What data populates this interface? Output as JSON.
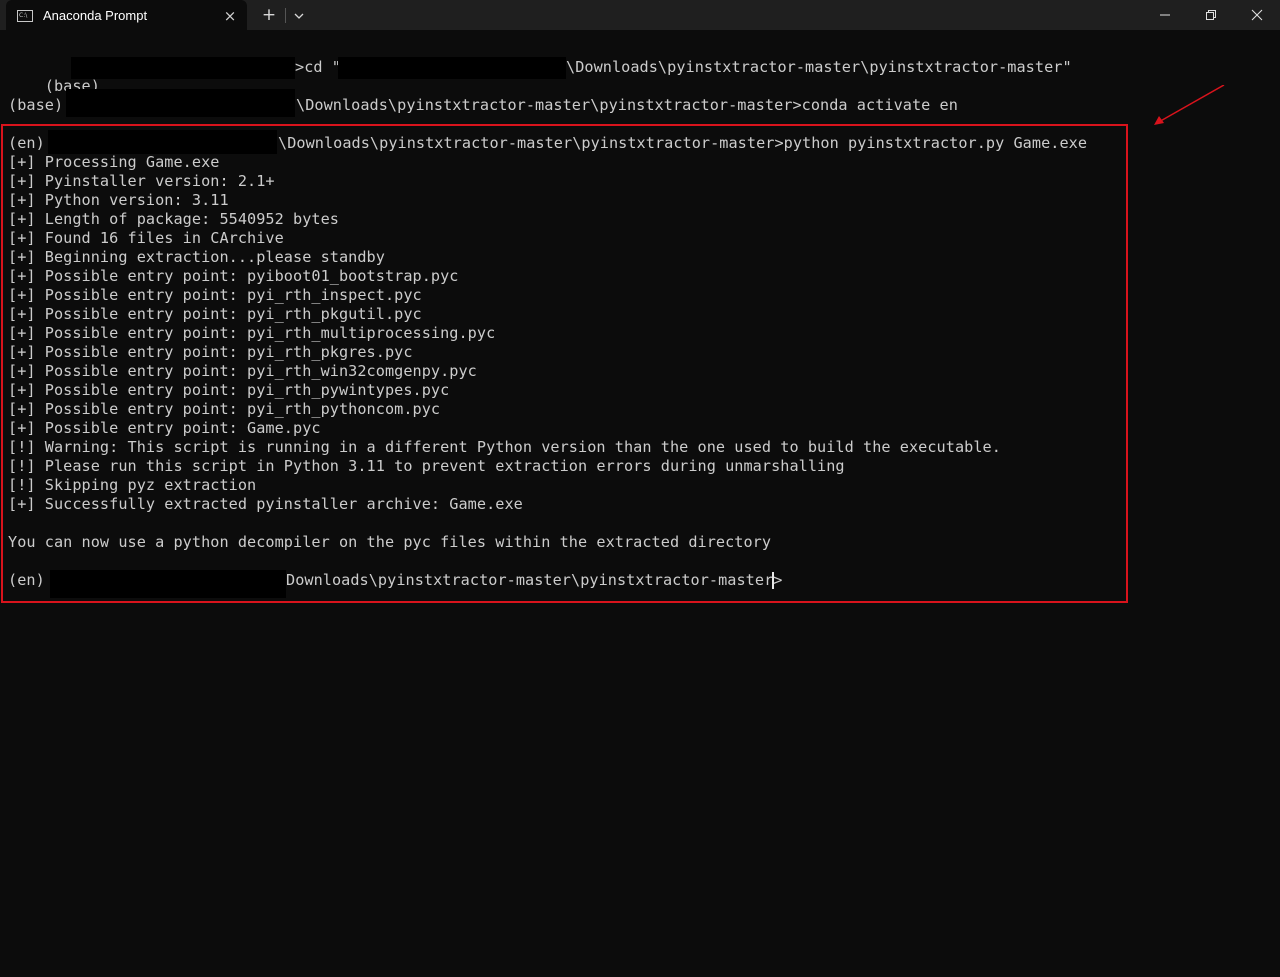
{
  "window": {
    "tab_title": "Anaconda Prompt",
    "tab_icon": "cmd-prompt-icon",
    "new_tab_icon": "+",
    "close_tab_icon": "×"
  },
  "colors": {
    "terminal_bg": "#0c0c0c",
    "terminal_fg": "#cccccc",
    "highlight": "#d9131c"
  },
  "terminal": {
    "line1_prefix": "(base) ",
    "line1_cmd": ">cd \"",
    "line1_path": "\\Downloads\\pyinstxtractor-master\\pyinstxtractor-master\"",
    "line2_prefix": "(base) ",
    "line2_rest": "\\Downloads\\pyinstxtractor-master\\pyinstxtractor-master>conda activate en",
    "line3_prefix": "(en) ",
    "line3_rest": "\\Downloads\\pyinstxtractor-master\\pyinstxtractor-master>python pyinstxtractor.py Game.exe",
    "output": [
      "[+] Processing Game.exe",
      "[+] Pyinstaller version: 2.1+",
      "[+] Python version: 3.11",
      "[+] Length of package: 5540952 bytes",
      "[+] Found 16 files in CArchive",
      "[+] Beginning extraction...please standby",
      "[+] Possible entry point: pyiboot01_bootstrap.pyc",
      "[+] Possible entry point: pyi_rth_inspect.pyc",
      "[+] Possible entry point: pyi_rth_pkgutil.pyc",
      "[+] Possible entry point: pyi_rth_multiprocessing.pyc",
      "[+] Possible entry point: pyi_rth_pkgres.pyc",
      "[+] Possible entry point: pyi_rth_win32comgenpy.pyc",
      "[+] Possible entry point: pyi_rth_pywintypes.pyc",
      "[+] Possible entry point: pyi_rth_pythoncom.pyc",
      "[+] Possible entry point: Game.pyc",
      "[!] Warning: This script is running in a different Python version than the one used to build the executable.",
      "[!] Please run this script in Python 3.11 to prevent extraction errors during unmarshalling",
      "[!] Skipping pyz extraction",
      "[+] Successfully extracted pyinstaller archive: Game.exe"
    ],
    "summary": "You can now use a python decompiler on the pyc files within the extracted directory",
    "final_prefix": "(en) ",
    "final_rest": "Downloads\\pyinstxtractor-master\\pyinstxtractor-master>"
  }
}
